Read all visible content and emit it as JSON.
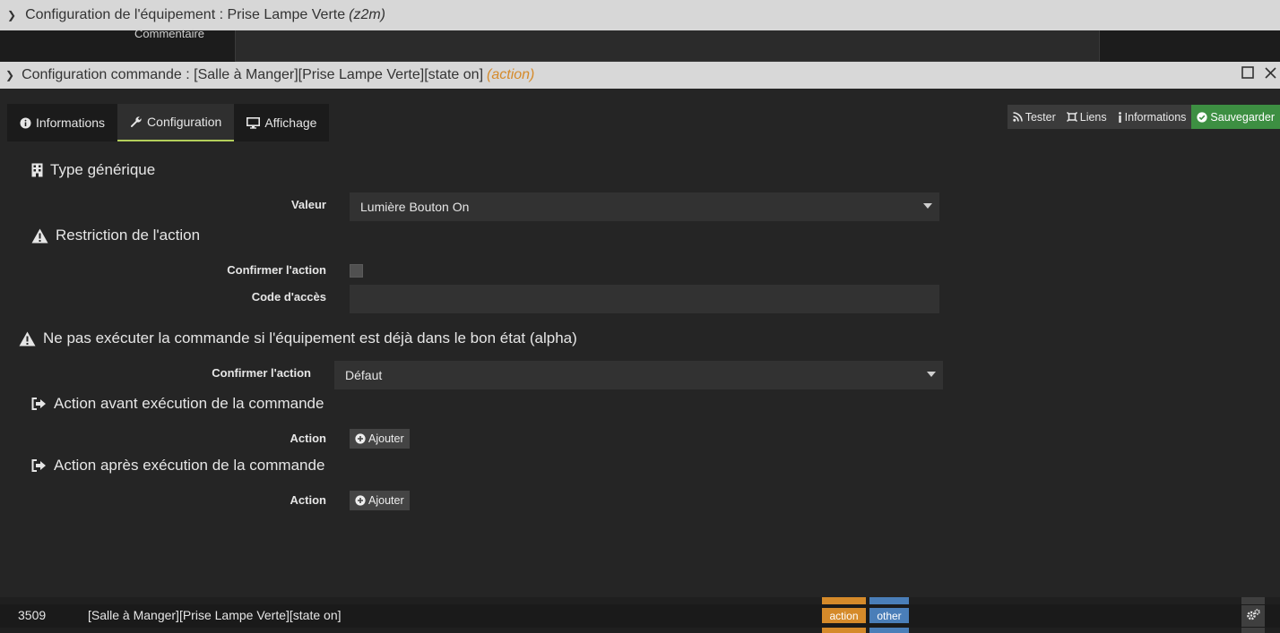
{
  "background_panel": {
    "title": "Configuration de l'équipement : Prise Lampe Verte",
    "title_suffix": "(z2m)",
    "cut_label": "Commentaire"
  },
  "dialog": {
    "title": "Configuration commande : [Salle à Manger][Prise Lampe Verte][state on]",
    "title_suffix": "(action)",
    "accent_color": "#d58a2a"
  },
  "tabs": [
    {
      "label": "Informations",
      "icon": "info-circle-icon"
    },
    {
      "label": "Configuration",
      "icon": "wrench-icon",
      "active": true
    },
    {
      "label": "Affichage",
      "icon": "monitor-icon"
    }
  ],
  "toolbar": {
    "tester": "Tester",
    "liens": "Liens",
    "informations": "Informations",
    "sauvegarder": "Sauvegarder",
    "save_color": "#3d8f42"
  },
  "generic_type": {
    "heading": "Type générique",
    "value_label": "Valeur",
    "value": "Lumière Bouton On"
  },
  "restriction": {
    "heading": "Restriction de l'action",
    "confirm_label": "Confirmer l'action",
    "access_code_label": "Code d'accès",
    "access_code_value": ""
  },
  "no_repeat": {
    "heading": "Ne pas exécuter la commande si l'équipement est déjà dans le bon état (alpha)",
    "confirm_label": "Confirmer l'action",
    "value": "Défaut"
  },
  "pre_action": {
    "heading": "Action avant exécution de la commande",
    "action_label": "Action",
    "add_label": "Ajouter"
  },
  "post_action": {
    "heading": "Action après exécution de la commande",
    "action_label": "Action",
    "add_label": "Ajouter"
  },
  "command_row": {
    "id": "3509",
    "name": "[Salle à Manger][Prise Lampe Verte][state on]",
    "type_tag": "action",
    "subtype_tag": "other",
    "tag_colors": {
      "type": "#d58a2a",
      "subtype": "#4a7eb8"
    }
  }
}
